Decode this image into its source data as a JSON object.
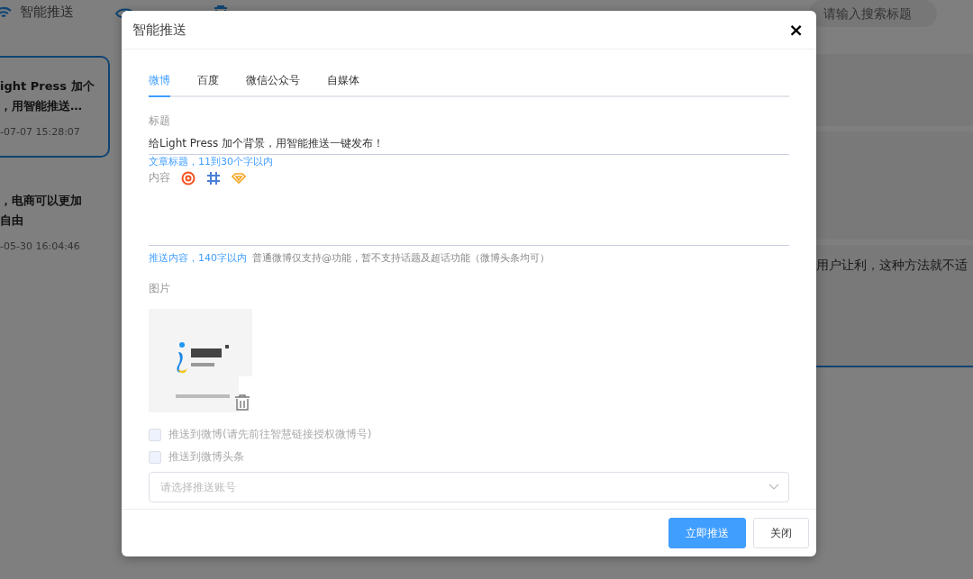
{
  "background": {
    "toolbar": {
      "title": "智能推送",
      "search": {
        "placeholder": "请输入搜索标题"
      }
    },
    "articles": [
      {
        "title_lines": [
          "ight Press 加个",
          "，用智能推送…"
        ],
        "time": "-07-07 15:28:07",
        "selected": true
      },
      {
        "title_lines": [
          "，电商可以更加",
          "自由"
        ],
        "time": "-05-30 16:04:46",
        "selected": false
      }
    ],
    "body_text": "用户让利，这种方法就不适"
  },
  "dialog": {
    "title": "智能推送",
    "close": "×",
    "tabs": [
      {
        "label": "微博",
        "selected": true
      },
      {
        "label": "百度",
        "selected": false
      },
      {
        "label": "微信公众号",
        "selected": false
      },
      {
        "label": "自媒体",
        "selected": false
      }
    ],
    "title_field": {
      "label": "标题",
      "value": "给Light Press 加个背景，用智能推送一键发布！",
      "hint": "文章标题，11到30个字以内"
    },
    "content_field": {
      "label": "内容",
      "hint": "推送内容，140字以内",
      "note": "普通微博仅支持@功能，暂不支持话题及超话功能（微博头条均可）"
    },
    "image_section": {
      "label": "图片"
    },
    "options": [
      {
        "label": "推送到微博(请先前往智慧链接授权微博号)",
        "checked": false
      },
      {
        "label": "推送到微博头条",
        "checked": false
      }
    ],
    "account_select": {
      "placeholder": "请选择推送账号"
    },
    "buttons": [
      {
        "label": "立即推送",
        "kind": "primary"
      },
      {
        "label": "关闭",
        "kind": "default"
      }
    ]
  }
}
